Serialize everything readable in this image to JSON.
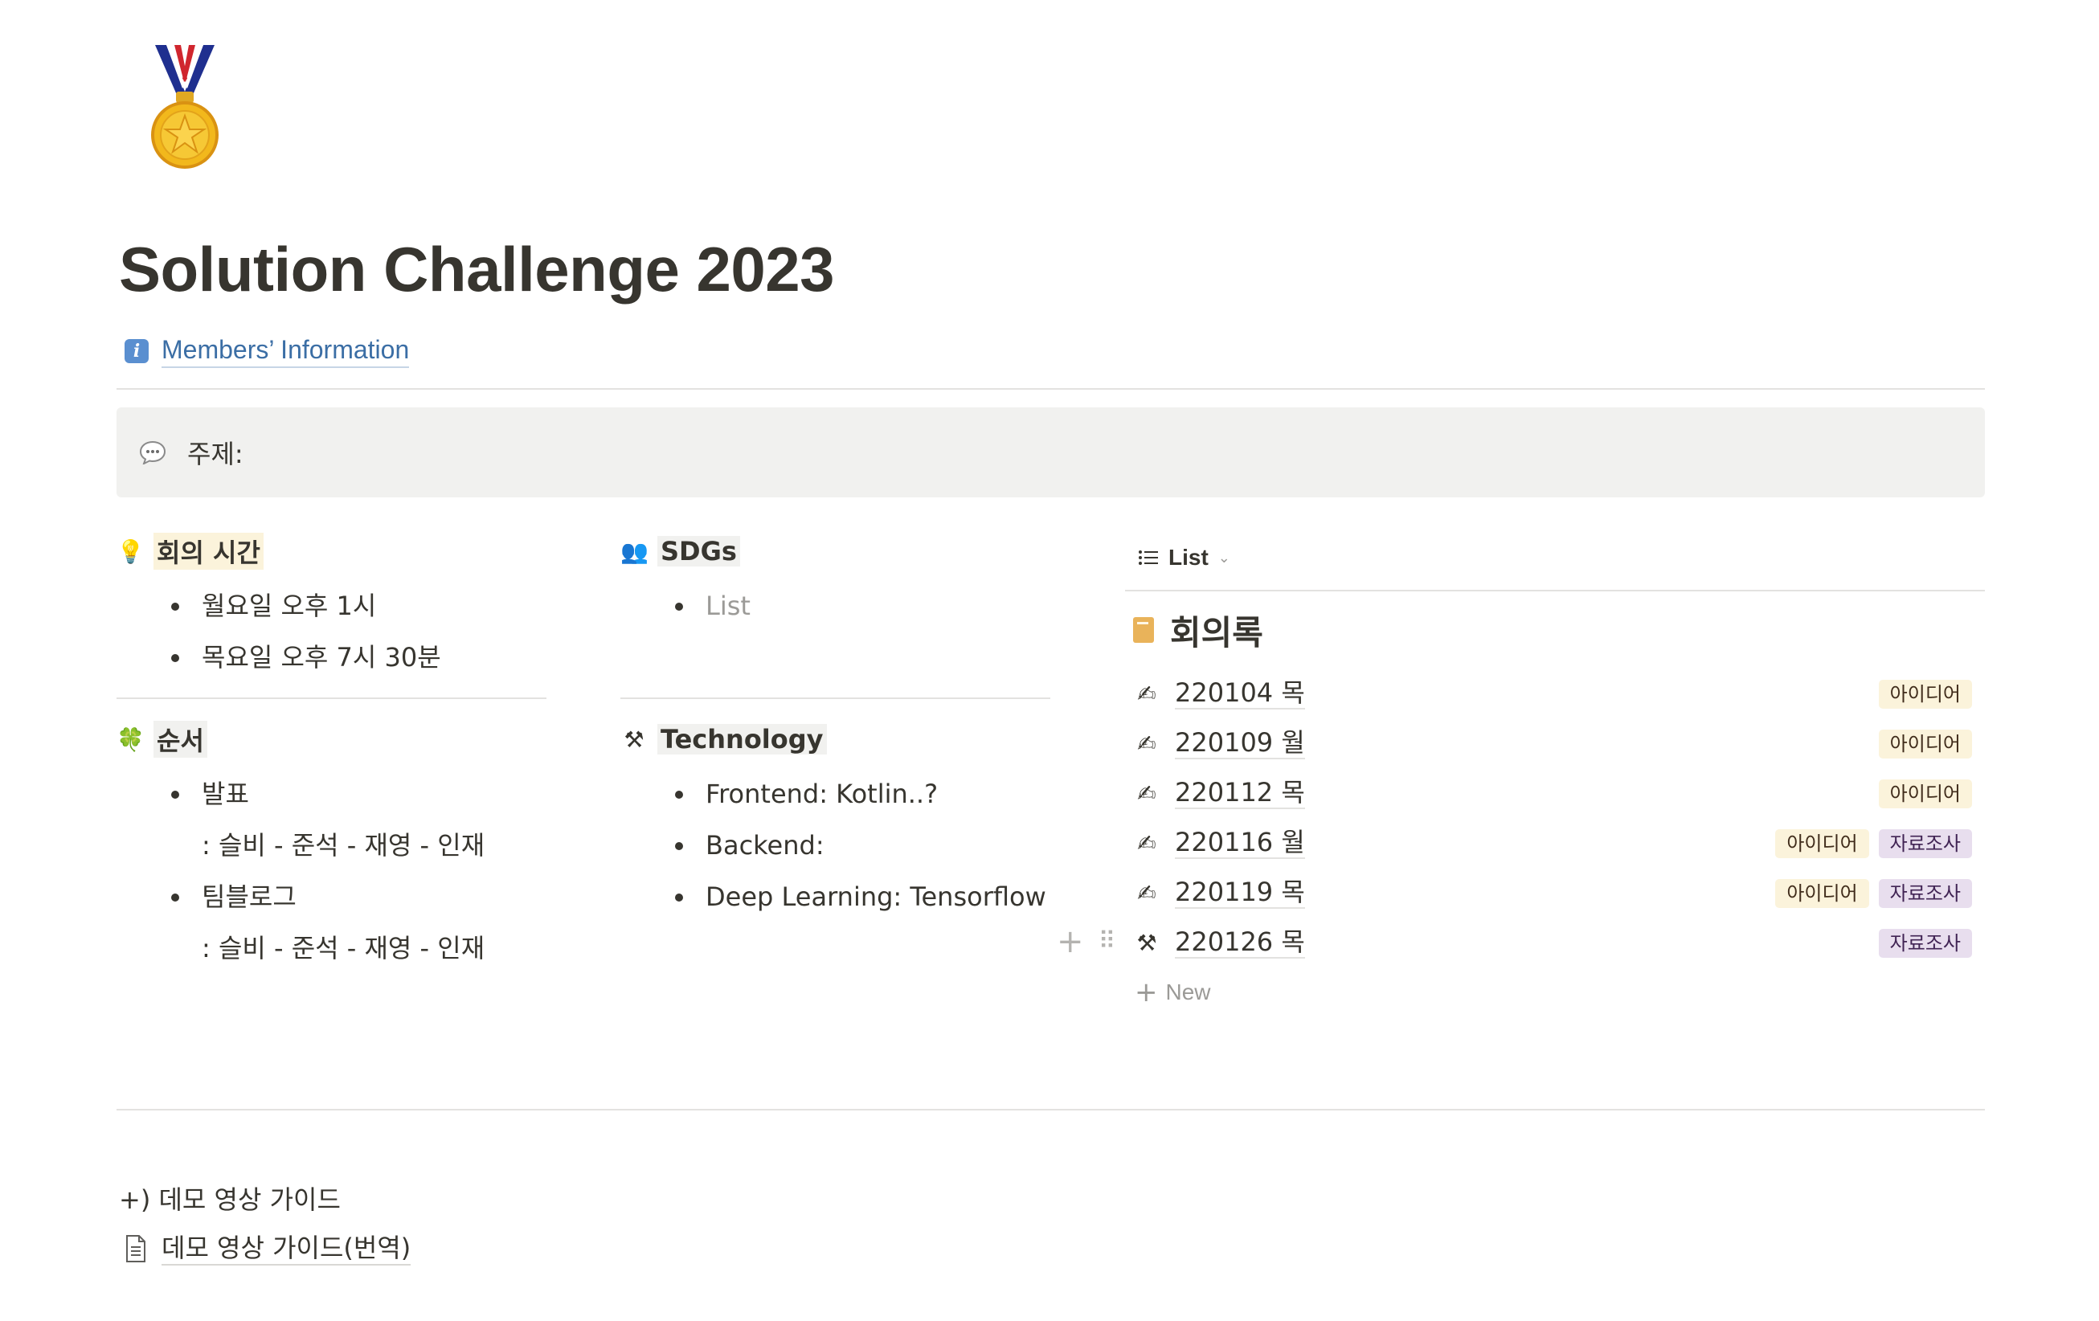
{
  "page": {
    "icon": "medal-icon",
    "title": "Solution Challenge 2023",
    "members_link": {
      "icon": "info-icon",
      "icon_glyph": "i",
      "label": "Members’ Information"
    },
    "callout": {
      "icon": "speech-bubble-icon",
      "text": "주제:"
    }
  },
  "meeting_time": {
    "icon": "💡",
    "icon_name": "lightbulb-icon",
    "heading": "회의 시간",
    "items": [
      "월요일 오후 1시",
      "목요일 오후 7시 30분"
    ]
  },
  "order": {
    "icon": "🍀",
    "icon_name": "clover-icon",
    "heading": "순서",
    "items": [
      {
        "label": "발표",
        "detail": ": 슬비 - 준석 - 재영 - 인재"
      },
      {
        "label": "팀블로그",
        "detail": ": 슬비 - 준석 - 재영 - 인재"
      }
    ]
  },
  "sdgs": {
    "icon": "👥",
    "icon_name": "people-icon",
    "heading": "SDGs",
    "items": [
      "List"
    ]
  },
  "technology": {
    "icon": "⚒",
    "icon_name": "hammer-and-wrench-icon",
    "heading": "Technology",
    "items": [
      "Frontend: Kotlin..?",
      "Backend:",
      "Deep Learning: Tensorflow"
    ]
  },
  "database": {
    "view_icon": "list-icon",
    "view_label": "List",
    "title_icon": "notebook-icon",
    "title": "회의록",
    "rows": [
      {
        "icon": "✍",
        "icon_name": "writing-hand-icon",
        "title": "220104 목",
        "tags": [
          {
            "label": "아이디어",
            "color": "#fbf3db"
          }
        ]
      },
      {
        "icon": "✍",
        "icon_name": "writing-hand-icon",
        "title": "220109 월",
        "tags": [
          {
            "label": "아이디어",
            "color": "#fbf3db"
          }
        ]
      },
      {
        "icon": "✍",
        "icon_name": "writing-hand-icon",
        "title": "220112 목",
        "tags": [
          {
            "label": "아이디어",
            "color": "#fbf3db"
          }
        ]
      },
      {
        "icon": "✍",
        "icon_name": "writing-hand-icon",
        "title": "220116 월",
        "tags": [
          {
            "label": "아이디어",
            "color": "#fbf3db"
          },
          {
            "label": "자료조사",
            "color": "#e8deee"
          }
        ]
      },
      {
        "icon": "✍",
        "icon_name": "writing-hand-icon",
        "title": "220119 목",
        "tags": [
          {
            "label": "아이디어",
            "color": "#fbf3db"
          },
          {
            "label": "자료조사",
            "color": "#e8deee"
          }
        ]
      },
      {
        "icon": "⚒",
        "icon_name": "hammer-and-pick-icon",
        "title": "220126 목",
        "tags": [
          {
            "label": "자료조사",
            "color": "#e8deee"
          }
        ]
      }
    ],
    "new_label": "New"
  },
  "bottom": {
    "text": "+) 데모 영상 가이드",
    "doc_icon": "page-icon",
    "doc_link": "데모 영상 가이드(번역)"
  },
  "colors": {
    "text": "#37352f",
    "link": "#3b6ea5",
    "callout_bg": "#f1f1ef",
    "tag_yellow": "#fbf3db",
    "tag_purple": "#e8deee",
    "muted": "#9b9a97"
  }
}
